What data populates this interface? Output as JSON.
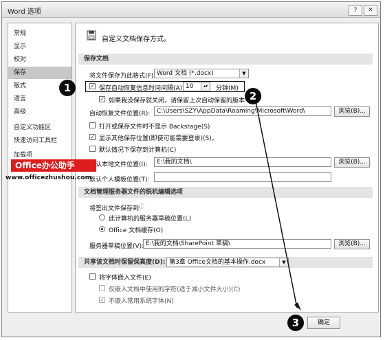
{
  "window": {
    "title": "Word 选项",
    "help": "?",
    "close": "✕"
  },
  "sidebar": {
    "items": [
      {
        "label": "常规",
        "selected": false
      },
      {
        "label": "显示",
        "selected": false
      },
      {
        "label": "校对",
        "selected": false
      },
      {
        "label": "保存",
        "selected": true
      },
      {
        "label": "版式",
        "selected": false
      },
      {
        "label": "语言",
        "selected": false
      },
      {
        "label": "高级",
        "selected": false
      },
      {
        "label": "自定义功能区",
        "selected": false
      },
      {
        "label": "快速访问工具栏",
        "selected": false
      },
      {
        "label": "加载项",
        "selected": false
      }
    ]
  },
  "main": {
    "heading": "自定义文档保存方式。",
    "save_section": {
      "header": "保存文档",
      "format_label": "将文件保存为此格式(F):",
      "format_value": "Word 文档 (*.docx)",
      "autorecover_label": "保存自动恢复信息时间间隔(A)",
      "autorecover_checked": true,
      "autorecover_minutes": "10",
      "minutes_label": "分钟(M)",
      "keep_last_label": "如果我没保存就关闭，请保留上次自动保留的版本",
      "keep_last_checked": true,
      "autorecover_location_label": "自动恢复文件位置(R):",
      "autorecover_location_value": "C:\\Users\\SZY\\AppData\\Roaming\\Microsoft\\Word\\",
      "browse_label": "浏览(B)...",
      "backstage_label": "打开或保存文件时不显示 Backstage(S)",
      "backstage_checked": false,
      "show_other_label": "显示其他保存位置(即使可能需要登录)(S)。",
      "show_other_checked": true,
      "default_computer_label": "默认情况下保存到计算机(C)",
      "default_computer_checked": false,
      "default_location_label": "默认本地文件位置(I):",
      "default_location_value": "E:\\我的文档\\",
      "browse2_label": "浏览(B)...",
      "template_location_label": "默认个人模板位置(T):",
      "template_location_value": ""
    },
    "offline_section": {
      "header": "文档管理服务器文件的脱机编辑选项",
      "checkout_label": "将签出文件保存到:",
      "info_icon": "info-icon",
      "option_server": "此计算机的服务器草稿位置(L)",
      "option_cache": "Office 文档缓存(O)",
      "selected": "Office 文档缓存(O)",
      "drafts_label": "服务器草稿位置(V):",
      "drafts_value": "E:\\我的文档\\SharePoint 草稿\\",
      "browse3_label": "浏览(B)..."
    },
    "fidelity_section": {
      "header": "共享该文档时保留保真度(D):",
      "doc_value": "第3章  Office文档的基本操作.docx",
      "embed_fonts_label": "将字体嵌入文件(E)",
      "embed_fonts_checked": false,
      "embed_chars_label": "仅嵌入文档中使用的字符(适于减小文件大小)(C)",
      "embed_chars_checked": false,
      "no_common_label": "不嵌入常用系统字体(N)",
      "no_common_checked": true
    }
  },
  "footer": {
    "ok_label": "确定"
  },
  "annotations": {
    "marker1": "1",
    "marker2": "2",
    "marker3": "3",
    "brand_name": "Office办公助手",
    "brand_url": "www.officezhushou.com"
  },
  "colors": {
    "brand_red": "#dd1c1c",
    "selected_item": "#c8c8c8",
    "section_header": "#e4e4e4"
  }
}
